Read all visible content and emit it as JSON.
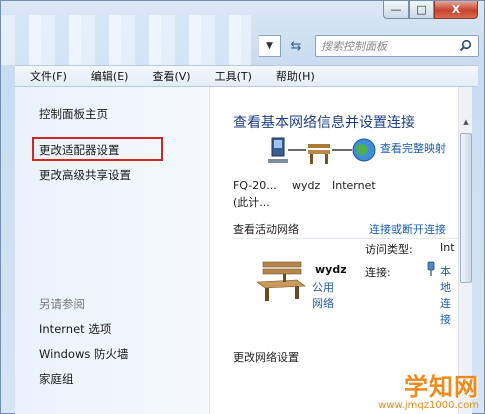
{
  "window": {
    "caption_min": "—",
    "caption_max": "□",
    "caption_close": "X"
  },
  "toolbar": {
    "dropdown_arrow": "▼",
    "refresh_glyph": "⇆",
    "search_placeholder": "搜索控制面板",
    "search_glyph": "⚲"
  },
  "menubar": {
    "items": [
      "文件(F)",
      "编辑(E)",
      "查看(V)",
      "工具(T)",
      "帮助(H)"
    ]
  },
  "sidebar": {
    "home": "控制面板主页",
    "adapter_settings": "更改适配器设置",
    "advanced_sharing": "更改高级共享设置",
    "see_also": "另请参阅",
    "internet_options": "Internet 选项",
    "firewall": "Windows 防火墙",
    "homegroup": "家庭组"
  },
  "main": {
    "help_glyph": "?",
    "heading": "查看基本网络信息并设置连接",
    "full_map_link": "查看完整映射",
    "nodes": {
      "pc_line1": "FQ-20...",
      "pc_line2": "(此计...",
      "network": "wydz",
      "internet": "Internet"
    },
    "active_networks_label": "查看活动网络",
    "connect_disconnect_link": "连接或断开连接",
    "network_name": "wydz",
    "network_type": "公用网络",
    "access_type_label": "访问类型:",
    "access_type_value": "Int",
    "connections_label": "连接:",
    "connection_value": "本地连接",
    "change_settings_label": "更改网络设置"
  },
  "watermark": {
    "main": "学知网",
    "url": "www.jmqz1000.com"
  },
  "colors": {
    "link": "#1e5fb3",
    "heading": "#1e3f8a",
    "highlight": "#d0282a",
    "watermark": "#f08a1c"
  }
}
